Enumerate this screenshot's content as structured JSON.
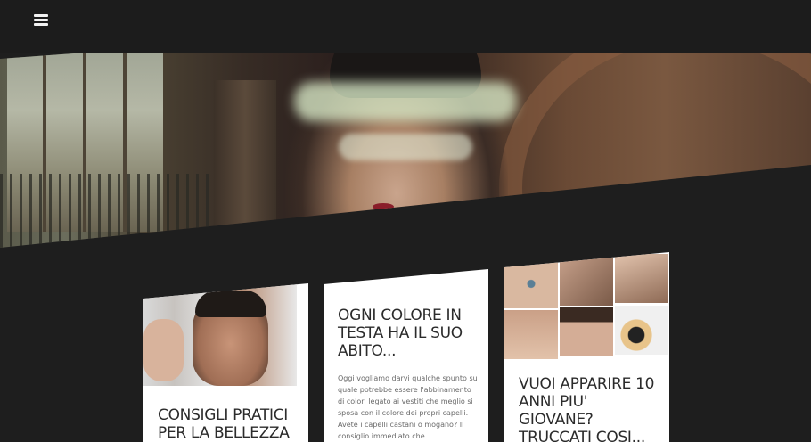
{
  "header": {
    "menu_icon": "hamburger-menu-icon"
  },
  "hero": {
    "title": "",
    "subtitle": ""
  },
  "posts": [
    {
      "title": "CONSIGLI PRATICI PER LA BELLEZZA",
      "excerpt": ""
    },
    {
      "title": "OGNI COLORE IN TESTA HA IL SUO ABITO...",
      "excerpt": "Oggi vogliamo darvi qualche spunto su quale potrebbe essere l'abbinamento di colori legato ai vestiti che meglio si sposa con il colore dei propri capelli. Avete i capelli castani o mogano? Il consiglio immediato che…"
    },
    {
      "title": "VUOI APPARIRE 10 ANNI PIU' GIOVANE? TRUCCATI COSI...",
      "excerpt": ""
    }
  ],
  "colors": {
    "background": "#1e1e1e",
    "card": "#ffffff",
    "title_text": "#2b2b2b",
    "excerpt_text": "#6a6a6a"
  }
}
